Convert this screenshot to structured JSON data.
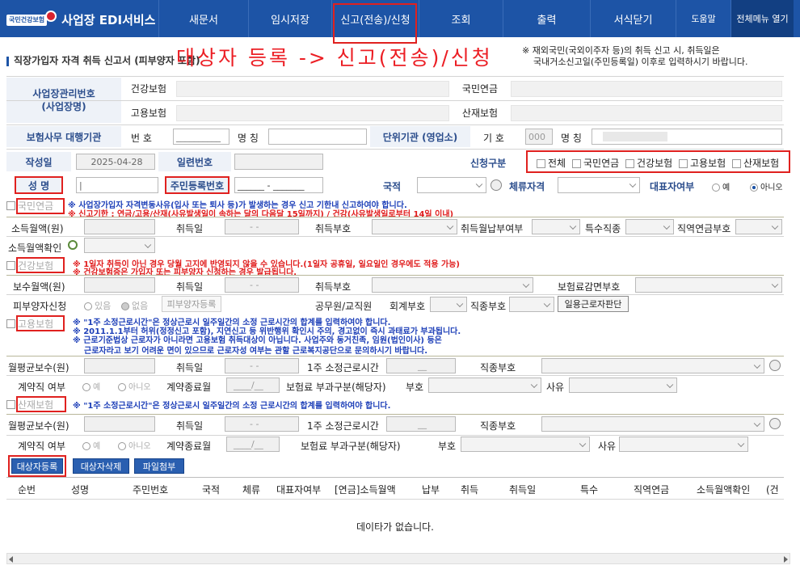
{
  "header": {
    "logo_badge": "국민건강보험",
    "app_title": "사업장 EDI서비스",
    "nav": [
      "새문서",
      "임시저장",
      "신고(전송)/신청",
      "조회",
      "출력",
      "서식닫기"
    ],
    "help": "도움말",
    "all_menu": "전체메뉴 열기"
  },
  "annotation": "대상자 등록 -> 신고(전송)/신청",
  "page_title": "직장가입자 자격 취득 신고서 (피부양자 포함)",
  "notice": [
    "※ 재외국민(국외이주자 등)의 취득 신고 시, 취득일은",
    "국내거소신고일(주민등록일) 이후로 입력하시기 바랍니다."
  ],
  "employer": {
    "label": "사업장관리번호\n(사업장명)",
    "health": "건강보험",
    "employment": "고용보험",
    "pension": "국민연금",
    "industrial": "산재보험"
  },
  "agency": {
    "label": "보험사무 대행기관",
    "num_label": "번 호",
    "num_value": "__________",
    "name_label": "명 칭",
    "unit_label": "단위기관 (영업소)",
    "sym_label": "기 호",
    "sym_value": "000",
    "unit_name_label": "명 칭"
  },
  "basic": {
    "date_label": "작성일",
    "date_value": "2025-04-28",
    "serial_label": "일련번호",
    "apply_label": "신청구분",
    "apply_opts": [
      "전체",
      "국민연금",
      "건강보험",
      "고용보험",
      "산재보험"
    ],
    "name_label": "성 명",
    "rrn_label": "주민등록번호",
    "rrn_value": "______ - _______",
    "nation_label": "국적",
    "stay_label": "체류자격",
    "rep_label": "대표자여부",
    "rep_yes": "예",
    "rep_no": "아니오"
  },
  "pension": {
    "title": "국민연금",
    "warn1": "※ 사업장가입자 자격변동사유(입사 또는 퇴사 등)가 발생하는 경우 신고 기한내 신고하여야 합니다.",
    "warn2": "※ 신고기한 : 연금/고용/산재(사유발생일이 속하는 달의 다음달 15일까지) / 건강(사유발생일로부터 14일 이내)",
    "income": "소득월액(원)",
    "acq_date": "취득일",
    "date_ph": "- -",
    "acq_code": "취득부호",
    "acq_pay": "취득월납부여부",
    "special": "특수직종",
    "job_pension": "직역연금부호",
    "income_confirm": "소득월액확인"
  },
  "health": {
    "title": "건강보험",
    "warn1": "※ 1일자 취득이 아닌 경우 당월 고지에 반영되지 않을 수 있습니다.(1일자 공휴일, 일요일인 경우에도 적용 가능)",
    "warn2": "※ 건강보험증은 가입자 또는 피부양자 신청하는 경우 발급됩니다.",
    "pay": "보수월액(원)",
    "acq_date": "취득일",
    "acq_code": "취득부호",
    "reduce": "보험료감면부호",
    "dependent": "피부양자신청",
    "dep_yes": "있음",
    "dep_no": "없음",
    "dep_btn": "피부양자등록",
    "civil": "공무원/교직원",
    "account": "회계부호",
    "jobcode": "직종부호",
    "daily_btn": "일용근로자판단"
  },
  "employment": {
    "title": "고용보험",
    "warn1": "※ \"1주 소정근로시간\"은 정상근로시 일주일간의 소정 근로시간의 합계를 입력하여야 합니다.",
    "warn2": "※ 2011.1.1부터 허위(정정신고 포함), 지연신고 등 위반행위 확인시 주의, 경고없이 즉시 과태료가 부과됩니다.",
    "warn3": "※ 근로기준법상 근로자가 아니라면 고용보험 취득대상이 아닙니다. 사업주와 동거친족, 임원(법인이사) 등은",
    "warn4": "근로자라고 보기 어려운 면이 있으므로 근로자성 여부는 관할 근로복지공단으로 문의하시기 바랍니다.",
    "avg_pay": "월평균보수(원)",
    "acq_date": "취득일",
    "weekly": "1주 소정근로시간",
    "hours_ph": "__",
    "jobcode": "직종부호",
    "contract": "계약직 여부",
    "yes": "예",
    "no": "아니오",
    "contract_end": "계약종료월",
    "month_ph": "____/__",
    "levy": "보험료 부과구분(해당자)",
    "code": "부호",
    "reason": "사유"
  },
  "industrial": {
    "title": "산재보험",
    "warn1": "※ \"1주 소정근로시간\"은 정상근로시 일주일간의 소정 근로시간의 합계를 입력하여야 합니다.",
    "avg_pay": "월평균보수(원)",
    "acq_date": "취득일",
    "weekly": "1주 소정근로시간",
    "jobcode": "직종부호",
    "contract": "계약직 여부",
    "yes": "예",
    "no": "아니오",
    "contract_end": "계약종료월",
    "levy": "보험료 부과구분(해당자)",
    "code": "부호",
    "reason": "사유"
  },
  "actions": [
    "대상자등록",
    "대상자삭제",
    "파일첨부"
  ],
  "grid": {
    "columns": [
      "순번",
      "성명",
      "주민번호",
      "국적",
      "체류",
      "대표자여부",
      "[연금]소득월액",
      "납부",
      "취득",
      "취득일",
      "특수",
      "직역연금",
      "소득월액확인",
      "(건"
    ],
    "empty": "데이타가 없습니다."
  },
  "colors": {
    "brand": "#1d54a6",
    "highlight": "#e0211f",
    "warning_blue": "#1d3fb8"
  }
}
